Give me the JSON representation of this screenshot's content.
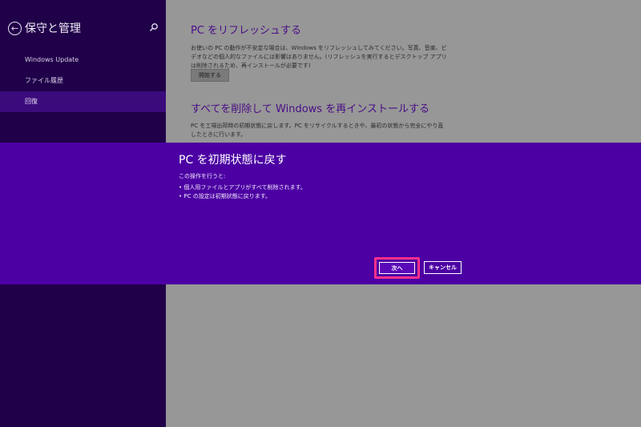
{
  "sidebar": {
    "title": "保守と管理",
    "items": [
      {
        "label": "Windows Update"
      },
      {
        "label": "ファイル履歴"
      },
      {
        "label": "回復"
      }
    ]
  },
  "content": {
    "refresh": {
      "title": "PC をリフレッシュする",
      "desc": "お使いの PC の動作が不安定な場合は、Windows をリフレッシュしてみてください。写真、音楽、ビデオなどの個人的なファイルには影響はありません。(リフレッシュを実行するとデスクトップ アプリは削除されるため、再インストールが必要です)",
      "button": "開始する"
    },
    "reset": {
      "title": "すべてを削除して Windows を再インストールする",
      "desc": "PC を工場出荷時の初期状態に戻します。PC をリサイクルするときや、最初の状態から完全にやり直したときに行います。"
    }
  },
  "dialog": {
    "title": "PC を初期状態に戻す",
    "intro": "この操作を行うと:",
    "items": [
      "個人用ファイルとアプリがすべて削除されます。",
      "PC の設定は初期状態に戻ります。"
    ],
    "next_label": "次へ",
    "cancel_label": "キャンセル"
  },
  "colors": {
    "sidebar_bg": "#200049",
    "sidebar_active": "#3b0b7c",
    "dialog_bg": "#4c00a3",
    "content_bg": "#979797",
    "highlight": "#ff2f8c",
    "title_purple": "#4a0d86"
  }
}
